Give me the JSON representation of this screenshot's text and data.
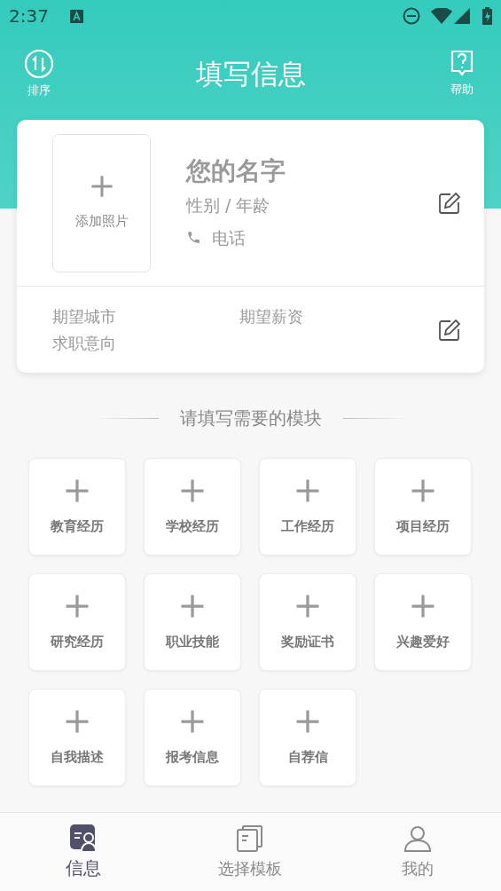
{
  "status_bar": {
    "time": "2:37"
  },
  "header": {
    "title": "填写信息",
    "left_action": "排序",
    "right_action": "帮助"
  },
  "profile": {
    "photo_label": "添加照片",
    "name": "您的名字",
    "gender_age": "性别 / 年龄",
    "phone": "电话",
    "city": "期望城市",
    "salary": "期望薪资",
    "intention": "求职意向"
  },
  "modules": {
    "title": "请填写需要的模块",
    "items": [
      {
        "label": "教育经历"
      },
      {
        "label": "学校经历"
      },
      {
        "label": "工作经历"
      },
      {
        "label": "项目经历"
      },
      {
        "label": "研究经历"
      },
      {
        "label": "职业技能"
      },
      {
        "label": "奖励证书"
      },
      {
        "label": "兴趣爱好"
      },
      {
        "label": "自我描述"
      },
      {
        "label": "报考信息"
      },
      {
        "label": "自荐信"
      }
    ]
  },
  "bottom_nav": [
    {
      "label": "信息",
      "kind": "info",
      "selected": true
    },
    {
      "label": "选择模板",
      "kind": "templates",
      "selected": false
    },
    {
      "label": "我的",
      "kind": "profile",
      "selected": false
    }
  ]
}
